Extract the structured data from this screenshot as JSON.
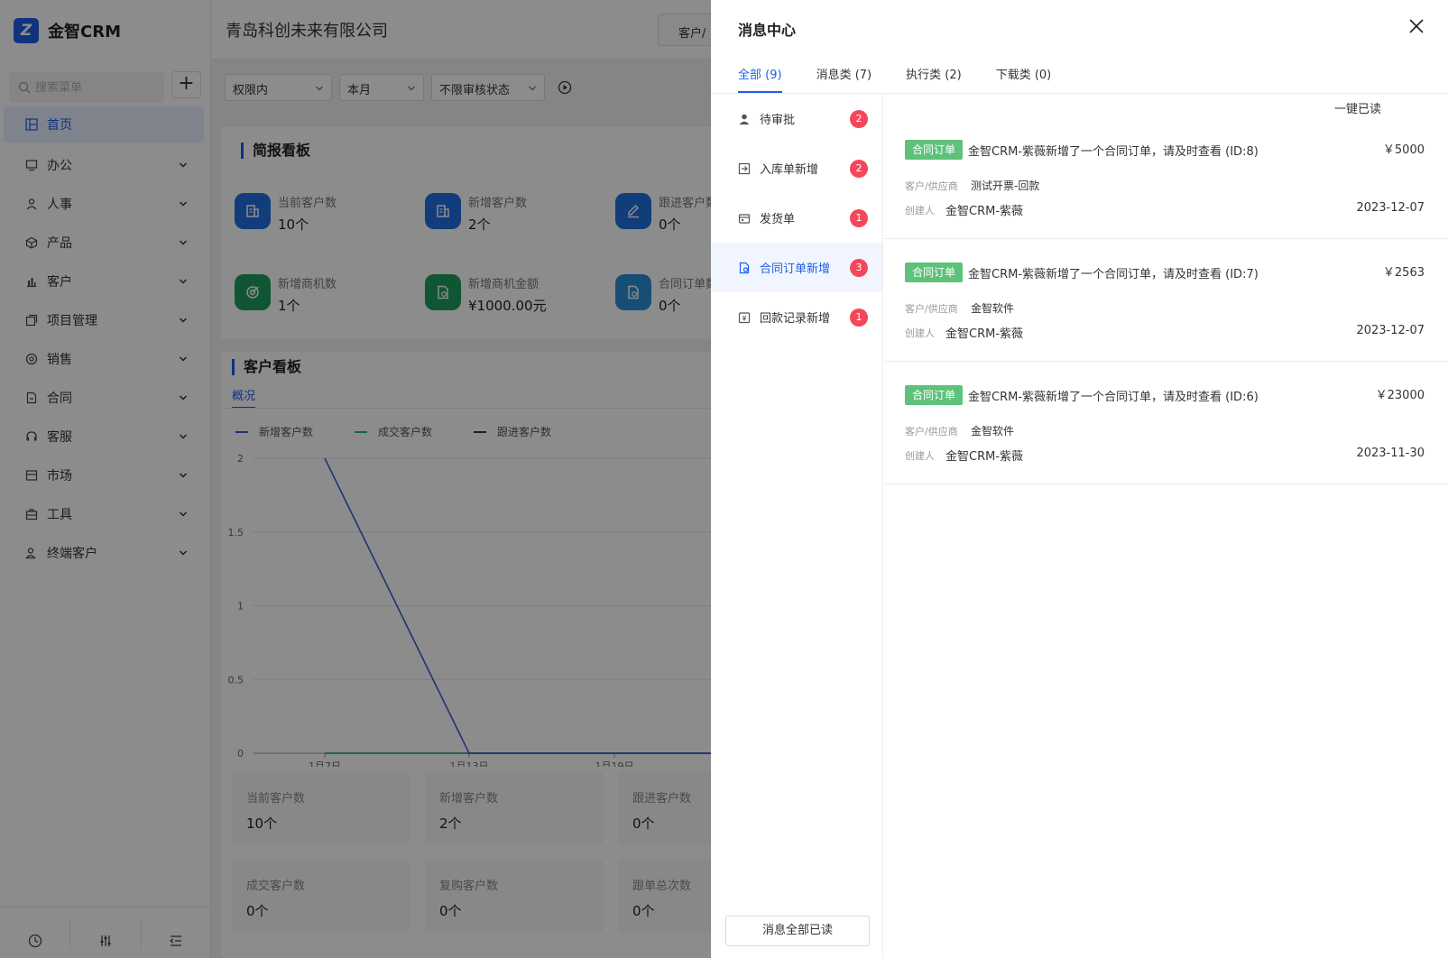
{
  "app": {
    "logo_text": "金智CRM",
    "company": "青岛科创未来有限公司",
    "header_tab": "客户/"
  },
  "sidebar": {
    "search_placeholder": "搜索菜单",
    "items": [
      {
        "label": "首页",
        "icon": "dashboard-icon"
      },
      {
        "label": "办公",
        "icon": "office-icon"
      },
      {
        "label": "人事",
        "icon": "people-icon"
      },
      {
        "label": "产品",
        "icon": "box-icon"
      },
      {
        "label": "客户",
        "icon": "customer-icon"
      },
      {
        "label": "项目管理",
        "icon": "project-icon"
      },
      {
        "label": "销售",
        "icon": "sales-icon"
      },
      {
        "label": "合同",
        "icon": "contract-icon"
      },
      {
        "label": "客服",
        "icon": "headset-icon"
      },
      {
        "label": "市场",
        "icon": "market-icon"
      },
      {
        "label": "工具",
        "icon": "toolbox-icon"
      },
      {
        "label": "终端客户",
        "icon": "terminal-customer-icon"
      }
    ]
  },
  "filters": {
    "scope": "权限内",
    "period": "本月",
    "audit": "不限审核状态"
  },
  "brief_board": {
    "title": "简报看板",
    "stats": [
      {
        "label": "当前客户数",
        "value": "10个",
        "color": "#1f6fe0"
      },
      {
        "label": "新增客户数",
        "value": "2个",
        "color": "#1f6fe0"
      },
      {
        "label": "跟进客户数",
        "value": "0个",
        "color": "#1f6fe0"
      },
      {
        "label": "新增商机数",
        "value": "1个",
        "color": "#1e9d5f"
      },
      {
        "label": "新增商机金额",
        "value": "¥1000.00元",
        "color": "#1e9d5f"
      },
      {
        "label": "合同订单数",
        "value": "0个",
        "color": "#2b8fd8"
      }
    ]
  },
  "customer_board": {
    "title": "客户看板",
    "subtab": "概况",
    "legend": [
      {
        "name": "新增客户数",
        "color": "#3d5bd8"
      },
      {
        "name": "成交客户数",
        "color": "#2eb873"
      },
      {
        "name": "跟进客户数",
        "color": "#2b3a5c"
      }
    ],
    "summary": [
      {
        "label": "当前客户数",
        "value": "10个"
      },
      {
        "label": "新增客户数",
        "value": "2个"
      },
      {
        "label": "跟进客户数",
        "value": "0个"
      },
      {
        "label": "成交客户数",
        "value": "0个"
      },
      {
        "label": "复购客户数",
        "value": "0个"
      },
      {
        "label": "跟单总次数",
        "value": "0个"
      }
    ]
  },
  "chart_data": {
    "type": "line",
    "x": [
      "1月7日",
      "1月13日",
      "1月19日"
    ],
    "y_ticks": [
      "0",
      "0.5",
      "1",
      "1.5",
      "2"
    ],
    "ylim": [
      0,
      2
    ],
    "grid": true,
    "series": [
      {
        "name": "新增客户数",
        "values": [
          2,
          0,
          0
        ],
        "color": "#3d5bd8"
      },
      {
        "name": "成交客户数",
        "values": [
          0,
          0,
          0
        ],
        "color": "#2eb873"
      },
      {
        "name": "跟进客户数",
        "values": [
          0,
          0,
          0
        ],
        "color": "#2b3a5c"
      }
    ]
  },
  "drawer": {
    "title": "消息中心",
    "tabs": [
      "全部 (9)",
      "消息类 (7)",
      "执行类 (2)",
      "下载类 (0)"
    ],
    "categories": [
      {
        "label": "待审批",
        "count": "2",
        "icon": "user-icon"
      },
      {
        "label": "入库单新增",
        "count": "2",
        "icon": "inbound-icon"
      },
      {
        "label": "发货单",
        "count": "1",
        "icon": "delivery-icon"
      },
      {
        "label": "合同订单新增",
        "count": "3",
        "icon": "contract-order-icon"
      },
      {
        "label": "回款记录新增",
        "count": "1",
        "icon": "payment-icon"
      }
    ],
    "mark_one_read": "一键已读",
    "mark_all_read": "消息全部已读",
    "messages": [
      {
        "tag": "合同订单",
        "text": "金智CRM-紫薇新增了一个合同订单，请及时查看 (ID:8)",
        "amount": "￥5000",
        "customer_label": "客户/供应商",
        "customer": "测试开票-回款",
        "creator_label": "创建人",
        "creator": "金智CRM-紫薇",
        "date": "2023-12-07"
      },
      {
        "tag": "合同订单",
        "text": "金智CRM-紫薇新增了一个合同订单，请及时查看 (ID:7)",
        "amount": "￥2563",
        "customer_label": "客户/供应商",
        "customer": "金智软件",
        "creator_label": "创建人",
        "creator": "金智CRM-紫薇",
        "date": "2023-12-07"
      },
      {
        "tag": "合同订单",
        "text": "金智CRM-紫薇新增了一个合同订单，请及时查看 (ID:6)",
        "amount": "￥23000",
        "customer_label": "客户/供应商",
        "customer": "金智软件",
        "creator_label": "创建人",
        "creator": "金智CRM-紫薇",
        "date": "2023-11-30"
      }
    ]
  }
}
